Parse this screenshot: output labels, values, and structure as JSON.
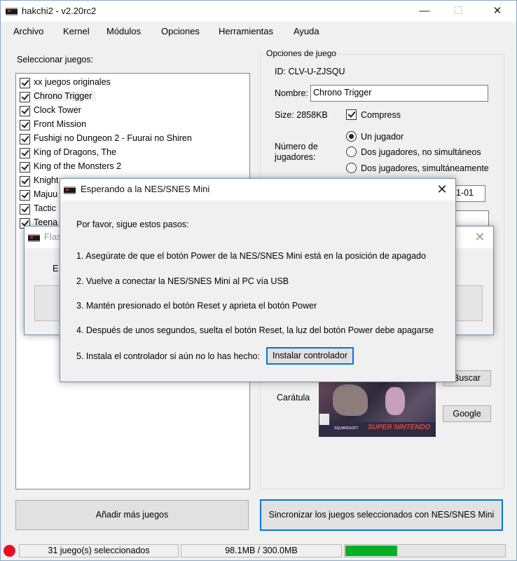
{
  "window": {
    "title": "hakchi2 - v2.20rc2",
    "minimize": "—",
    "maximize": "☐",
    "close": "✕"
  },
  "menu": {
    "items": [
      "Archivo",
      "Kernel",
      "Módulos",
      "Opciones",
      "Herramientas",
      "Ayuda"
    ]
  },
  "games_panel": {
    "label": "Seleccionar juegos:",
    "games": [
      "xx juegos originales",
      "Chrono Trigger",
      "Clock Tower",
      "Front Mission",
      "Fushigi no Dungeon 2 - Fuurai no Shiren",
      "King of Dragons, The",
      "King of the Monsters 2",
      "Knight",
      "Majuu",
      "Tactic",
      "Teena"
    ]
  },
  "options": {
    "label": "Opciones de juego",
    "id": "ID: CLV-U-ZJSQU",
    "name_label": "Nombre:",
    "name_value": "Chrono Trigger",
    "size": "Size: 2858KB",
    "compress_label": "Compress",
    "players_label": "Número de jugadores:",
    "players_options": [
      "Un jugador",
      "Dos jugadores, no simultáneos",
      "Dos jugadores, simultáneamente"
    ],
    "date_value": "01-01",
    "search_button": "Buscar",
    "cover_label": "Carátula",
    "google_button": "Google"
  },
  "flash_dialog": {
    "title": "Flas",
    "text": "E"
  },
  "waiting_dialog": {
    "title": "Esperando a la NES/SNES Mini",
    "intro": "Por favor, sigue estos pasos:",
    "steps": [
      "1. Asegúrate de que el botón Power de la NES/SNES Mini está en la posición de apagado",
      "2. Vuelve a conectar la NES/SNES Mini al PC vía USB",
      "3. Mantén presionado el botón Reset y aprieta el botón Power",
      "4. Después de unos segundos, suelta el botón Reset, la luz del botón Power debe apagarse",
      "5. Instala el controlador si aún no lo has hecho:"
    ],
    "install_button": "Instalar controlador"
  },
  "buttons": {
    "add_games": "Añadir más juegos",
    "sync": "Sincronizar los juegos seleccionados con NES/SNES Mini"
  },
  "cover_art": {
    "publisher": "SQUARESOFT",
    "platform": "SUPER NINTENDO"
  },
  "statusbar": {
    "selected": "31 juego(s) seleccionados",
    "storage": "98.1MB / 300.0MB",
    "storage_fill": 0.327
  },
  "colors": {
    "accent": "#0078d7",
    "progress": "#06b025",
    "status_dot": "#e81123"
  }
}
